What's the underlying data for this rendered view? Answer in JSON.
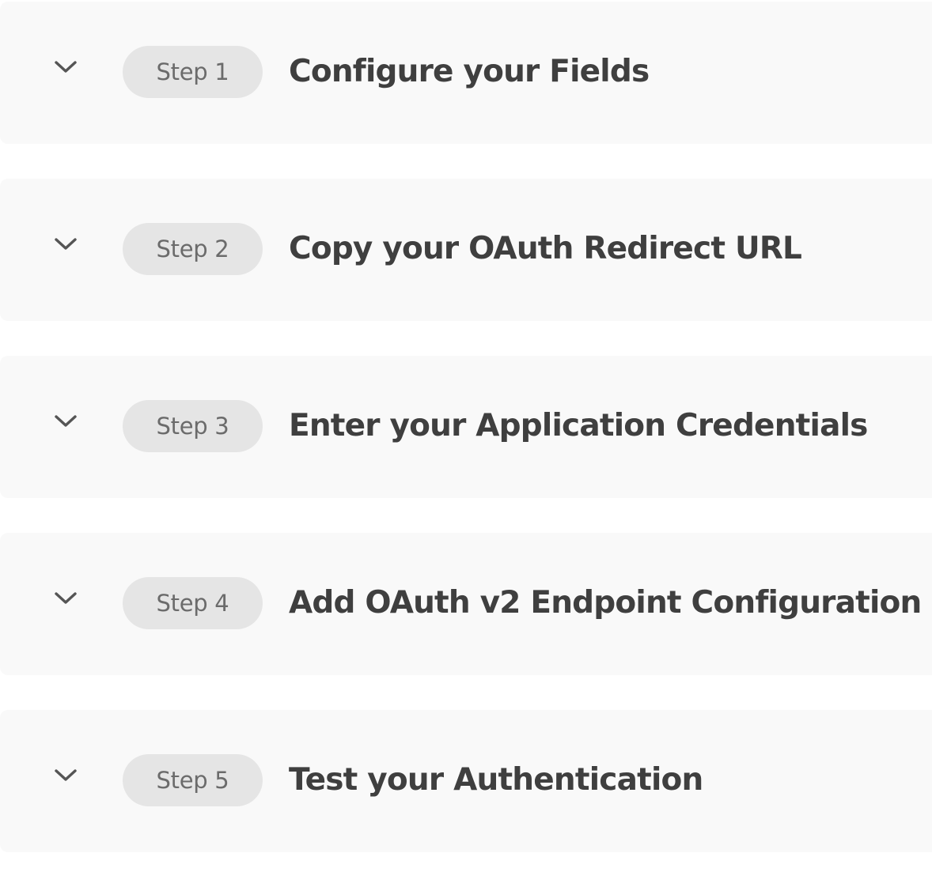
{
  "steps": [
    {
      "badge": "Step 1",
      "title": "Configure your Fields",
      "icon": "chevron-down-icon"
    },
    {
      "badge": "Step 2",
      "title": "Copy your OAuth Redirect URL",
      "icon": "chevron-down-icon"
    },
    {
      "badge": "Step 3",
      "title": "Enter your Application Credentials",
      "icon": "chevron-down-icon"
    },
    {
      "badge": "Step 4",
      "title": "Add OAuth v2 Endpoint Configuration",
      "icon": "chevron-down-icon"
    },
    {
      "badge": "Step 5",
      "title": "Test your Authentication",
      "icon": "chevron-down-icon"
    }
  ],
  "colors": {
    "card_background": "#f9f9f9",
    "badge_background": "#e5e5e5",
    "badge_text": "#6b6b6b",
    "title_text": "#3f3f3f",
    "icon": "#555555"
  }
}
